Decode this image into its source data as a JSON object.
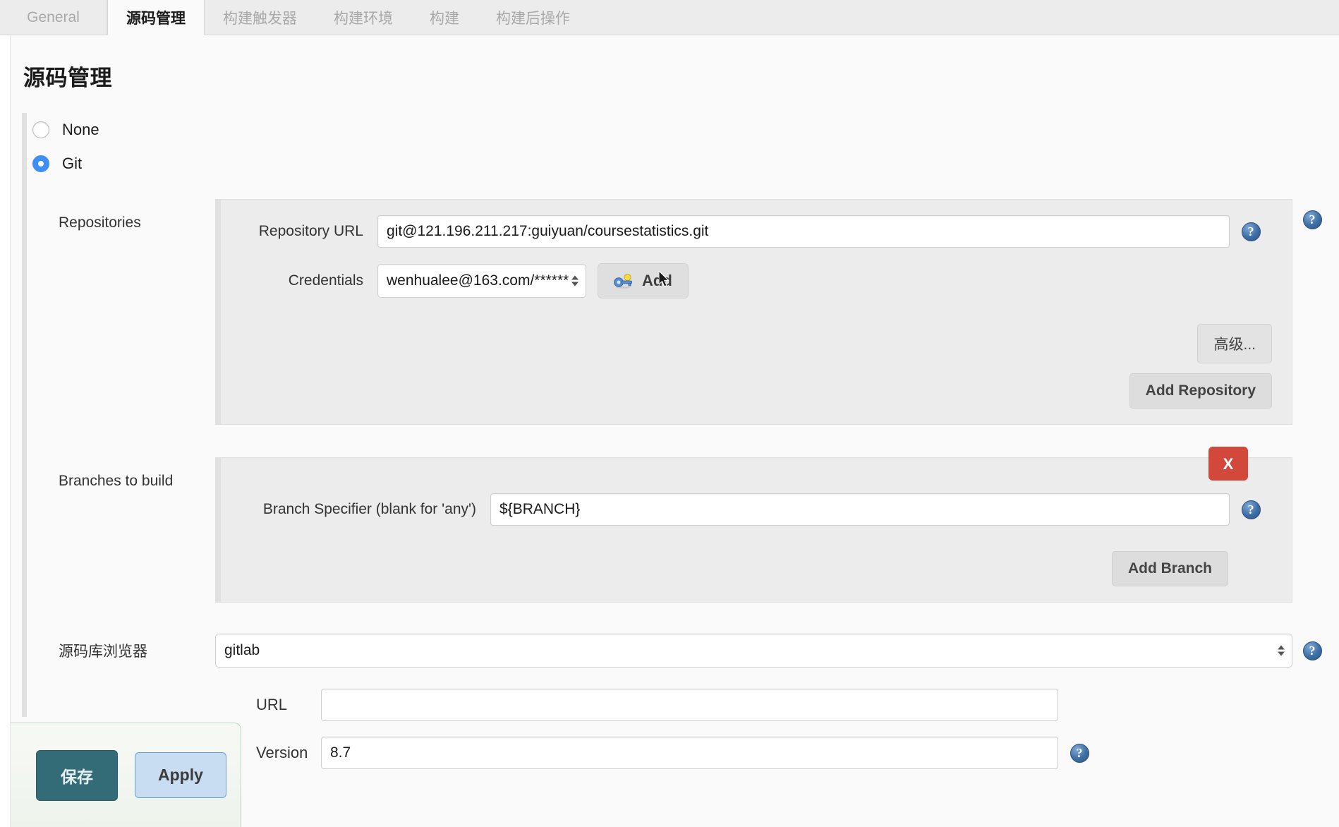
{
  "tabs": [
    {
      "label": "General",
      "active": false
    },
    {
      "label": "源码管理",
      "active": true
    },
    {
      "label": "构建触发器",
      "active": false
    },
    {
      "label": "构建环境",
      "active": false
    },
    {
      "label": "构建",
      "active": false
    },
    {
      "label": "构建后操作",
      "active": false
    }
  ],
  "page": {
    "title": "源码管理"
  },
  "scm": {
    "options": [
      {
        "label": "None",
        "selected": false
      },
      {
        "label": "Git",
        "selected": true
      }
    ]
  },
  "repositories": {
    "section_label": "Repositories",
    "repository_url_label": "Repository URL",
    "repository_url_value": "git@121.196.211.217:guiyuan/coursestatistics.git",
    "credentials_label": "Credentials",
    "credentials_value": "wenhualee@163.com/******",
    "add_credentials_label": "Add",
    "add_credentials_icon": "key-icon",
    "advanced_label": "高级...",
    "add_repository_label": "Add Repository"
  },
  "branches": {
    "section_label": "Branches to build",
    "branch_specifier_label": "Branch Specifier (blank for 'any')",
    "branch_specifier_value": "${BRANCH}",
    "delete_label": "X",
    "add_branch_label": "Add Branch"
  },
  "browser": {
    "label": "源码库浏览器",
    "selected": "gitlab",
    "url_label": "URL",
    "url_value": "",
    "version_label": "Version",
    "version_value": "8.7"
  },
  "footer": {
    "save_label": "保存",
    "apply_label": "Apply"
  },
  "icons": {
    "help": "?"
  },
  "colors": {
    "accent_blue": "#3e8ef7",
    "delete_red": "#d2493c",
    "save_teal": "#336b77",
    "apply_blue": "#c8dcf2",
    "panel_gray": "#ececec",
    "page_bg": "#fafafa"
  }
}
